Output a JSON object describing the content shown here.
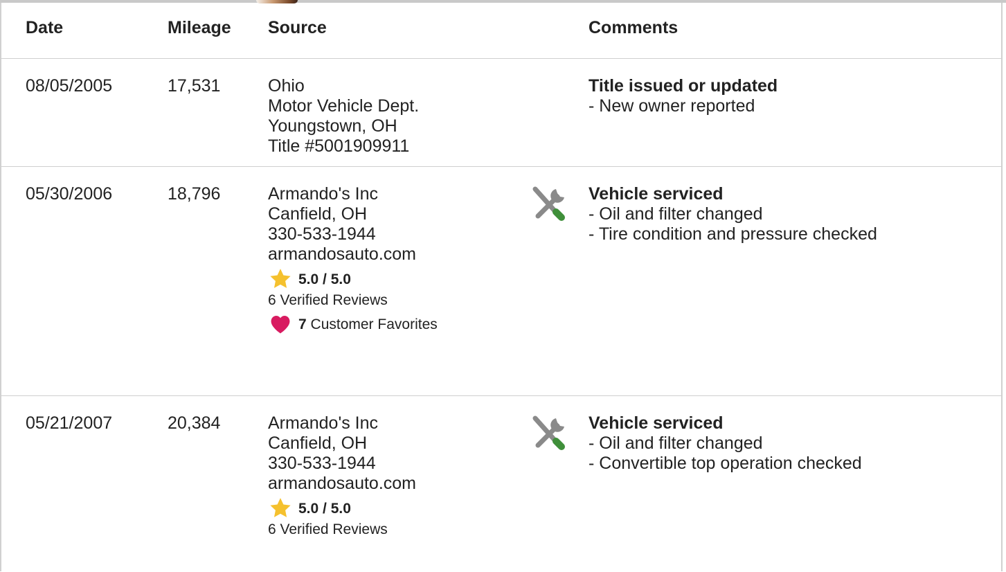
{
  "columns": {
    "date": "Date",
    "mileage": "Mileage",
    "source": "Source",
    "comments": "Comments"
  },
  "records": [
    {
      "date": "08/05/2005",
      "mileage": "17,531",
      "source": [
        "Ohio",
        "Motor Vehicle Dept.",
        "Youngstown, OH",
        "Title #5001909911"
      ],
      "comment_title": "Title issued or updated",
      "comment_items": [
        "- New owner reported"
      ]
    },
    {
      "date": "05/30/2006",
      "mileage": "18,796",
      "source": [
        "Armando's Inc",
        "Canfield, OH",
        "330-533-1944",
        "armandosauto.com"
      ],
      "rating": "5.0 / 5.0",
      "reviews": "6 Verified Reviews",
      "favorites_count": "7",
      "favorites_label": "Customer Favorites",
      "icon": "service-tools-icon",
      "comment_title": "Vehicle serviced",
      "comment_items": [
        "- Oil and filter changed",
        "- Tire condition and pressure checked"
      ]
    },
    {
      "date": "05/21/2007",
      "mileage": "20,384",
      "source": [
        "Armando's Inc",
        "Canfield, OH",
        "330-533-1944",
        "armandosauto.com"
      ],
      "rating": "5.0 / 5.0",
      "reviews": "6 Verified Reviews",
      "icon": "service-tools-icon",
      "comment_title": "Vehicle serviced",
      "comment_items": [
        "- Oil and filter changed",
        "- Convertible top operation checked"
      ]
    }
  ],
  "colors": {
    "star": "#F5C12E",
    "heart": "#D81B60",
    "wrench": "#8A8A8A",
    "screwdriver_handle": "#3F8F3A",
    "divider": "#CFCFCF"
  }
}
